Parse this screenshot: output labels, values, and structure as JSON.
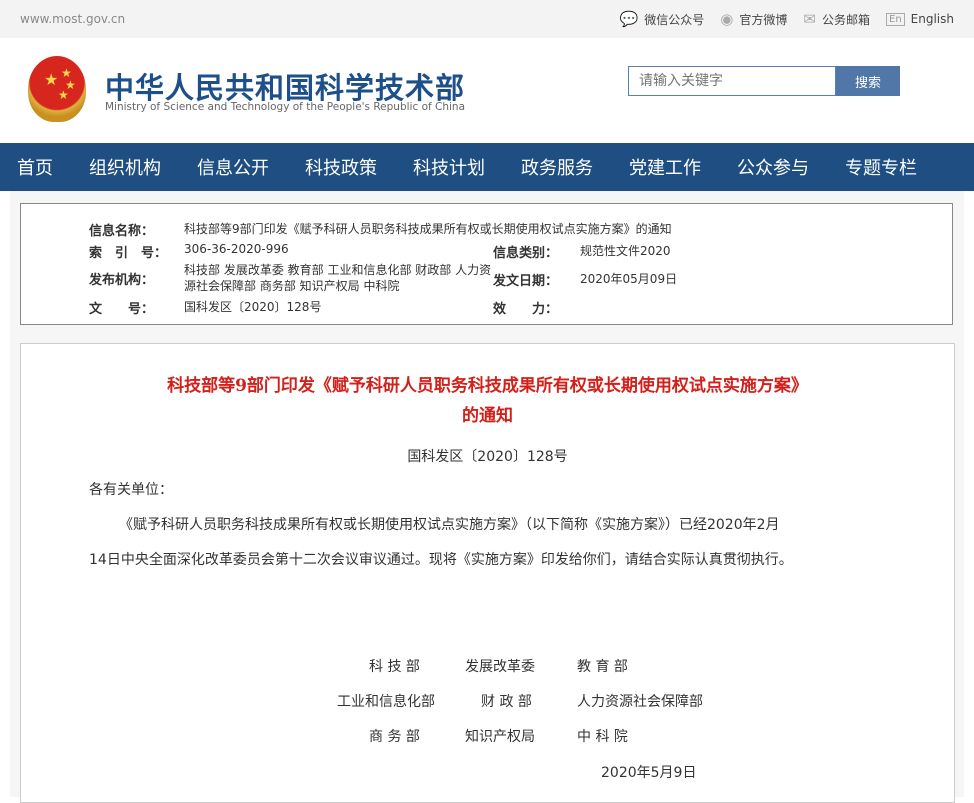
{
  "topbar": {
    "url": "www.most.gov.cn",
    "links": [
      {
        "label": "微信公众号",
        "icon": "wechat-icon"
      },
      {
        "label": "官方微博",
        "icon": "weibo-icon"
      },
      {
        "label": "公务邮箱",
        "icon": "mail-icon"
      },
      {
        "label": "English",
        "icon": "En"
      }
    ]
  },
  "header": {
    "title_cn": "中华人民共和国科学技术部",
    "title_en": "Ministry of Science and Technology of the People's Republic of China",
    "search_placeholder": "请输入关键字",
    "search_button": "搜索"
  },
  "nav": [
    "首页",
    "组织机构",
    "信息公开",
    "科技政策",
    "科技计划",
    "政务服务",
    "党建工作",
    "公众参与",
    "专题专栏"
  ],
  "info": {
    "name_label": "信息名称：",
    "name": "科技部等9部门印发《赋予科研人员职务科技成果所有权或长期使用权试点实施方案》的通知",
    "index_label": "索　引　号：",
    "index": "306-36-2020-996",
    "category_label": "信息类别：",
    "category": "规范性文件2020",
    "publisher_label": "发布机构：",
    "publisher": "科技部 发展改革委 教育部 工业和信息化部 财政部 人力资源社会保障部 商务部 知识产权局 中科院",
    "date_label": "发文日期：",
    "date": "2020年05月09日",
    "docno_label": "文　　号：",
    "docno": "国科发区〔2020〕128号",
    "validity_label": "效　　力：",
    "validity": ""
  },
  "doc": {
    "title_line1": "科技部等9部门印发《赋予科研人员职务科技成果所有权或长期使用权试点实施方案》",
    "title_line2": "的通知",
    "docno": "国科发区〔2020〕128号",
    "salutation": "各有关单位：",
    "body_line1": "《赋予科研人员职务科技成果所有权或长期使用权试点实施方案》（以下简称《实施方案》）已经2020年2月",
    "body_line2": "14日中央全面深化改革委员会第十二次会议审议通过。现将《实施方案》印发给你们，请结合实际认真贯彻执行。",
    "signers": [
      [
        "科 技 部",
        "发展改革委",
        "教 育 部"
      ],
      [
        "工业和信息化部",
        "财 政 部",
        "人力资源社会保障部"
      ],
      [
        "商 务 部",
        "知识产权局",
        "中 科 院"
      ]
    ],
    "date": "2020年5月9日"
  },
  "colors": {
    "nav": "#1f4e82",
    "title": "#d4201a",
    "search_button": "#5077a8"
  }
}
